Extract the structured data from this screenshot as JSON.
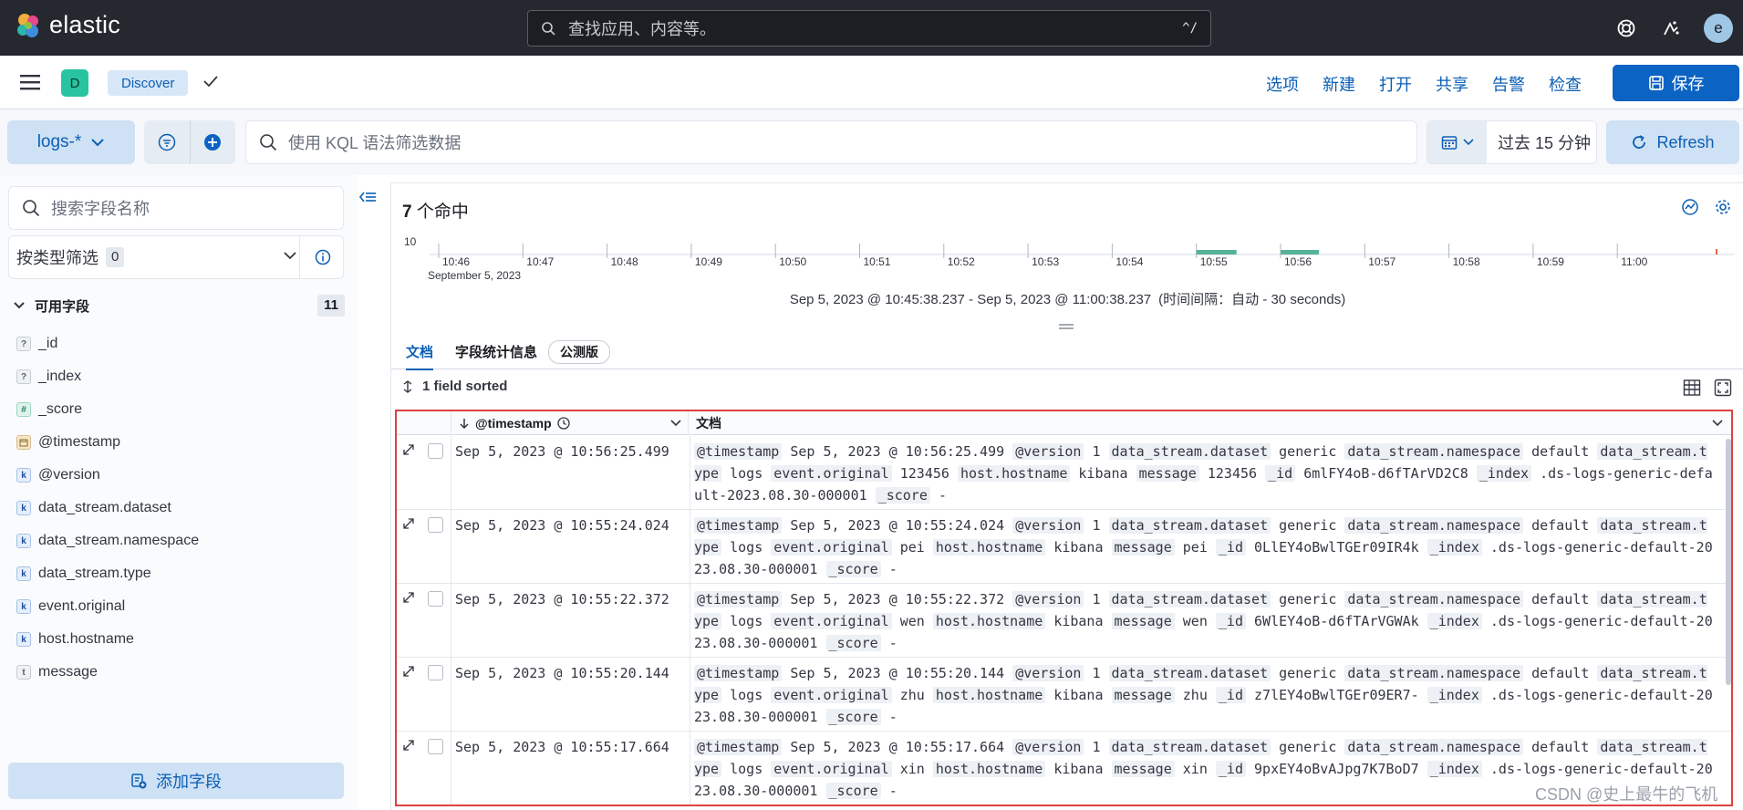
{
  "header": {
    "brand": "elastic",
    "search_placeholder": "查找应用、内容等。",
    "search_shortcut": "^/",
    "avatar_letter": "e"
  },
  "appbar": {
    "space_letter": "D",
    "breadcrumb": "Discover",
    "nav": [
      "选项",
      "新建",
      "打开",
      "共享",
      "告警",
      "检查"
    ],
    "save_label": "保存"
  },
  "querybar": {
    "dataview": "logs-*",
    "kql_placeholder": "使用 KQL 语法筛选数据",
    "time_range": "过去 15 分钟",
    "refresh_label": "Refresh"
  },
  "sidebar": {
    "search_placeholder": "搜索字段名称",
    "type_filter_label": "按类型筛选",
    "type_filter_count": "0",
    "available_label": "可用字段",
    "available_count": "11",
    "fields": [
      {
        "type": "?",
        "name": "_id"
      },
      {
        "type": "?",
        "name": "_index"
      },
      {
        "type": "#",
        "name": "_score"
      },
      {
        "type": "cal",
        "name": "@timestamp"
      },
      {
        "type": "k",
        "name": "@version"
      },
      {
        "type": "k",
        "name": "data_stream.dataset"
      },
      {
        "type": "k",
        "name": "data_stream.namespace"
      },
      {
        "type": "k",
        "name": "data_stream.type"
      },
      {
        "type": "k",
        "name": "event.original"
      },
      {
        "type": "k",
        "name": "host.hostname"
      },
      {
        "type": "t",
        "name": "message"
      }
    ],
    "add_field_label": "添加字段"
  },
  "main": {
    "hits_count": "7",
    "hits_label": " 个命中",
    "range_text": "Sep 5, 2023 @ 10:45:38.237 - Sep 5, 2023 @ 11:00:38.237",
    "interval_text": "(时间间隔：自动 - 30 seconds)",
    "tabs": {
      "docs": "文档",
      "stats": "字段统计信息",
      "beta": "公测版"
    },
    "sorted_label": "1 field sorted",
    "col_timestamp": "@timestamp",
    "col_doc": "文档"
  },
  "chart_data": {
    "type": "bar",
    "y_tick": "10",
    "x_ticks": [
      "10:46",
      "10:47",
      "10:48",
      "10:49",
      "10:50",
      "10:51",
      "10:52",
      "10:53",
      "10:54",
      "10:55",
      "10:56",
      "10:57",
      "10:58",
      "10:59",
      "11:00"
    ],
    "date_label": "September 5, 2023",
    "bars": [
      {
        "x": "10:55",
        "color": "#54b399"
      },
      {
        "x": "10:56",
        "color": "#54b399"
      }
    ]
  },
  "rows": [
    {
      "ts": "Sep 5, 2023 @ 10:56:25.499",
      "version": "1",
      "dataset": "generic",
      "namespace": "default",
      "type": "logs",
      "original": "123456",
      "hostname": "kibana",
      "message": "123456",
      "id": "6mlFY4oB-d6fTArVD2C8",
      "index": ".ds-logs-generic-default-2023.08.30-000001",
      "score": "-"
    },
    {
      "ts": "Sep 5, 2023 @ 10:55:24.024",
      "version": "1",
      "dataset": "generic",
      "namespace": "default",
      "type": "logs",
      "original": "pei",
      "hostname": "kibana",
      "message": "pei",
      "id": "0LlEY4oBwlTGEr09IR4k",
      "index": ".ds-logs-generic-default-2023.08.30-000001",
      "score": "-"
    },
    {
      "ts": "Sep 5, 2023 @ 10:55:22.372",
      "version": "1",
      "dataset": "generic",
      "namespace": "default",
      "type": "logs",
      "original": "wen",
      "hostname": "kibana",
      "message": "wen",
      "id": "6WlEY4oB-d6fTArVGWAk",
      "index": ".ds-logs-generic-default-2023.08.30-000001",
      "score": "-"
    },
    {
      "ts": "Sep 5, 2023 @ 10:55:20.144",
      "version": "1",
      "dataset": "generic",
      "namespace": "default",
      "type": "logs",
      "original": "zhu",
      "hostname": "kibana",
      "message": "zhu",
      "id": "z7lEY4oBwlTGEr09ER7-",
      "index": ".ds-logs-generic-default-2023.08.30-000001",
      "score": "-"
    },
    {
      "ts": "Sep 5, 2023 @ 10:55:17.664",
      "version": "1",
      "dataset": "generic",
      "namespace": "default",
      "type": "logs",
      "original": "xin",
      "hostname": "kibana",
      "message": "xin",
      "id": "9pxEY4oBvAJpg7K7BoD7",
      "index": ".ds-logs-generic-default-2023.08.30-000001",
      "score": "-"
    }
  ],
  "watermark": "CSDN @史上最牛的飞机"
}
